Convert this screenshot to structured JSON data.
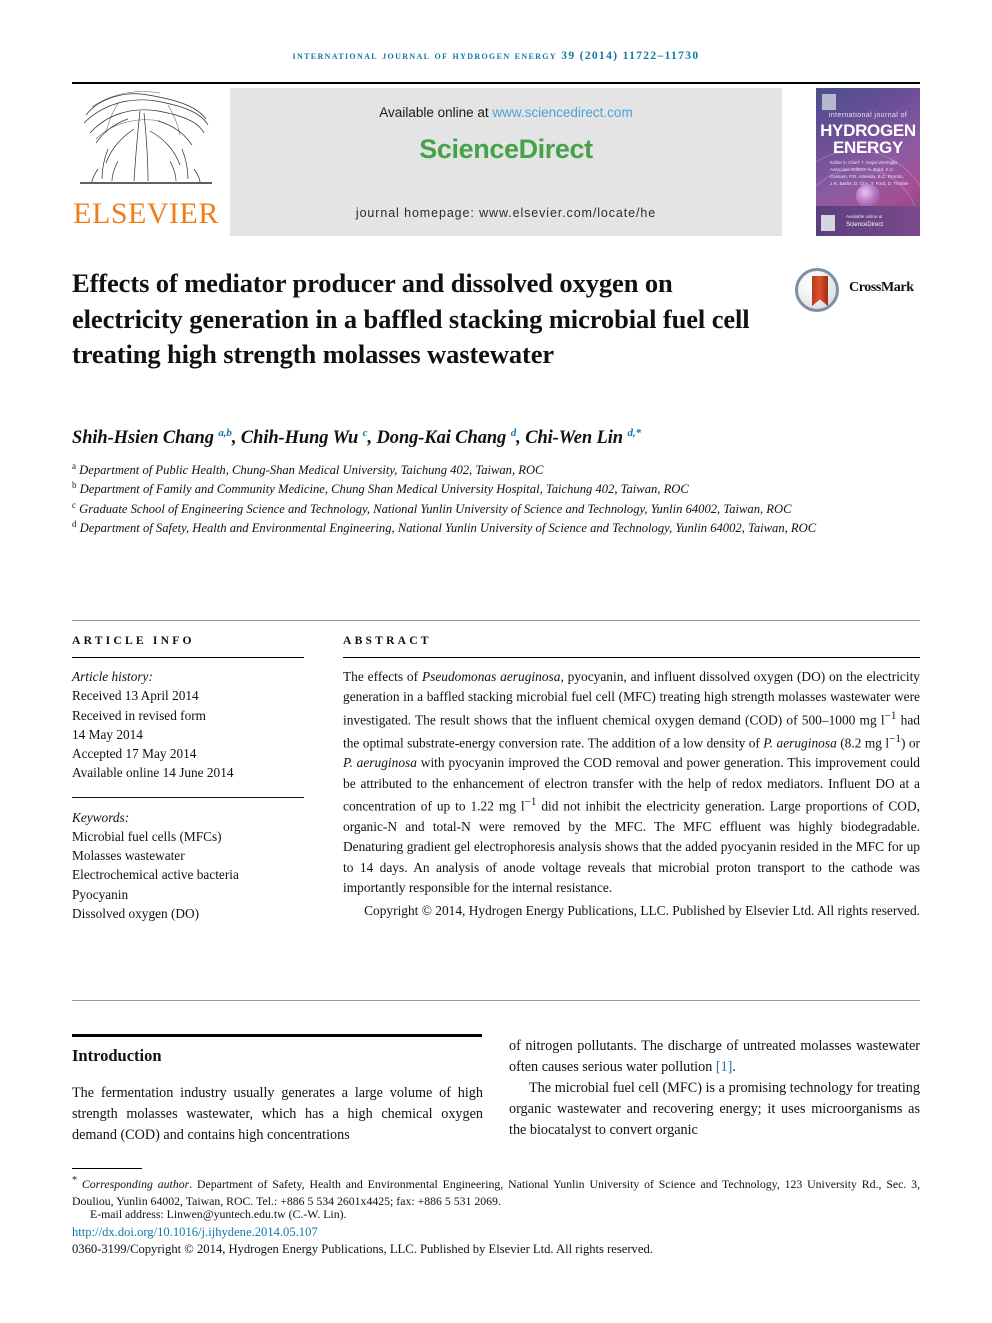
{
  "running_head": "International Journal of Hydrogen Energy 39 (2014) 11722–11730",
  "masthead": {
    "publisher_name": "ELSEVIER",
    "available_prefix": "Available online at ",
    "available_url": "www.sciencedirect.com",
    "sciencedirect_logo": "ScienceDirect",
    "journal_homepage": "journal homepage: www.elsevier.com/locate/he",
    "cover": {
      "kicker": "international journal of",
      "line1": "HYDROGEN",
      "line2": "ENERGY",
      "editor_block": "Editor in Chief: T. Nejat Veziroğlu\nAssociate Editors: A. Bard, K.C. Graham, P.R. Almeida,\nB.C. Rombo, J.R. Barbir,\nD. Chu, T. Ford, D. Trimble",
      "footer_brand": "ScienceDirect",
      "footer_small": "Available online at"
    }
  },
  "article": {
    "title": "Effects of mediator producer and dissolved oxygen on electricity generation in a baffled stacking microbial fuel cell treating high strength molasses wastewater",
    "crossmark_label": "CrossMark",
    "authors": [
      {
        "name": "Shih-Hsien Chang",
        "marks": "a,b",
        "sep": ", "
      },
      {
        "name": "Chih-Hung Wu",
        "marks": "c",
        "sep": ", "
      },
      {
        "name": "Dong-Kai Chang",
        "marks": "d",
        "sep": ", "
      },
      {
        "name": "Chi-Wen Lin",
        "marks": "d,*",
        "sep": ""
      }
    ],
    "affiliations": [
      {
        "mark": "a",
        "text": "Department of Public Health, Chung-Shan Medical University, Taichung 402, Taiwan, ROC"
      },
      {
        "mark": "b",
        "text": "Department of Family and Community Medicine, Chung Shan Medical University Hospital, Taichung 402, Taiwan, ROC"
      },
      {
        "mark": "c",
        "text": "Graduate School of Engineering Science and Technology, National Yunlin University of Science and Technology, Yunlin 64002, Taiwan, ROC"
      },
      {
        "mark": "d",
        "text": "Department of Safety, Health and Environmental Engineering, National Yunlin University of Science and Technology, Yunlin 64002, Taiwan, ROC"
      }
    ]
  },
  "article_info": {
    "heading": "ARTICLE INFO",
    "history_label": "Article history:",
    "history": [
      "Received 13 April 2014",
      "Received in revised form",
      "14 May 2014",
      "Accepted 17 May 2014",
      "Available online 14 June 2014"
    ],
    "keywords_label": "Keywords:",
    "keywords": [
      "Microbial fuel cells (MFCs)",
      "Molasses wastewater",
      "Electrochemical active bacteria",
      "Pyocyanin",
      "Dissolved oxygen (DO)"
    ]
  },
  "abstract": {
    "heading": "ABSTRACT",
    "paragraph_html": "The effects of <i>Pseudomonas aeruginosa</i>, pyocyanin, and influent dissolved oxygen (DO) on the electricity generation in a baffled stacking microbial fuel cell (MFC) treating high strength molasses wastewater were investigated. The result shows that the influent chemical oxygen demand (COD) of 500–1000 mg l<sup>−1</sup> had the optimal substrate-energy conversion rate. The addition of a low density of <i>P. aeruginosa</i> (8.2 mg l<sup>−1</sup>) or <i>P. aeruginosa</i> with pyocyanin improved the COD removal and power generation. This improvement could be attributed to the enhancement of electron transfer with the help of redox mediators. Influent DO at a concentration of up to 1.22 mg l<sup>−1</sup> did not inhibit the electricity generation. Large proportions of COD, organic-N and total-N were removed by the MFC. The MFC effluent was highly biodegradable. Denaturing gradient gel electrophoresis analysis shows that the added pyocyanin resided in the MFC for up to 14 days. An analysis of anode voltage reveals that microbial proton transport to the cathode was importantly responsible for the internal resistance.",
    "copyright": "Copyright © 2014, Hydrogen Energy Publications, LLC. Published by Elsevier Ltd. All rights reserved."
  },
  "introduction": {
    "heading": "Introduction",
    "left_paragraph": "The fermentation industry usually generates a large volume of high strength molasses wastewater, which has a high chemical oxygen demand (COD) and contains high concentrations",
    "right_paragraph_1_pre": "of nitrogen pollutants. The discharge of untreated molasses wastewater often causes serious water pollution ",
    "right_paragraph_1_ref": "[1]",
    "right_paragraph_1_post": ".",
    "right_paragraph_2": "The microbial fuel cell (MFC) is a promising technology for treating organic wastewater and recovering energy; it uses microorganisms as the biocatalyst to convert organic"
  },
  "footer": {
    "corresponding_label": "Corresponding author",
    "corresponding_text": ". Department of Safety, Health and Environmental Engineering, National Yunlin University of Science and Technology, 123 University Rd., Sec. 3, Douliou, Yunlin 64002, Taiwan, ROC. Tel.: +886 5 534 2601x4425; fax: +886 5 531 2069.",
    "email_label": "E-mail address: ",
    "email": "Linwen@yuntech.edu.tw",
    "email_suffix": " (C.-W. Lin).",
    "doi": "http://dx.doi.org/10.1016/j.ijhydene.2014.05.107",
    "issn_copyright": "0360-3199/Copyright © 2014, Hydrogen Energy Publications, LLC. Published by Elsevier Ltd. All rights reserved."
  },
  "colors": {
    "accent_blue": "#1277a8",
    "elsevier_orange": "#ef7d1a",
    "sciencedirect_green": "#46a24a",
    "link_blue": "#4aa3d8"
  }
}
